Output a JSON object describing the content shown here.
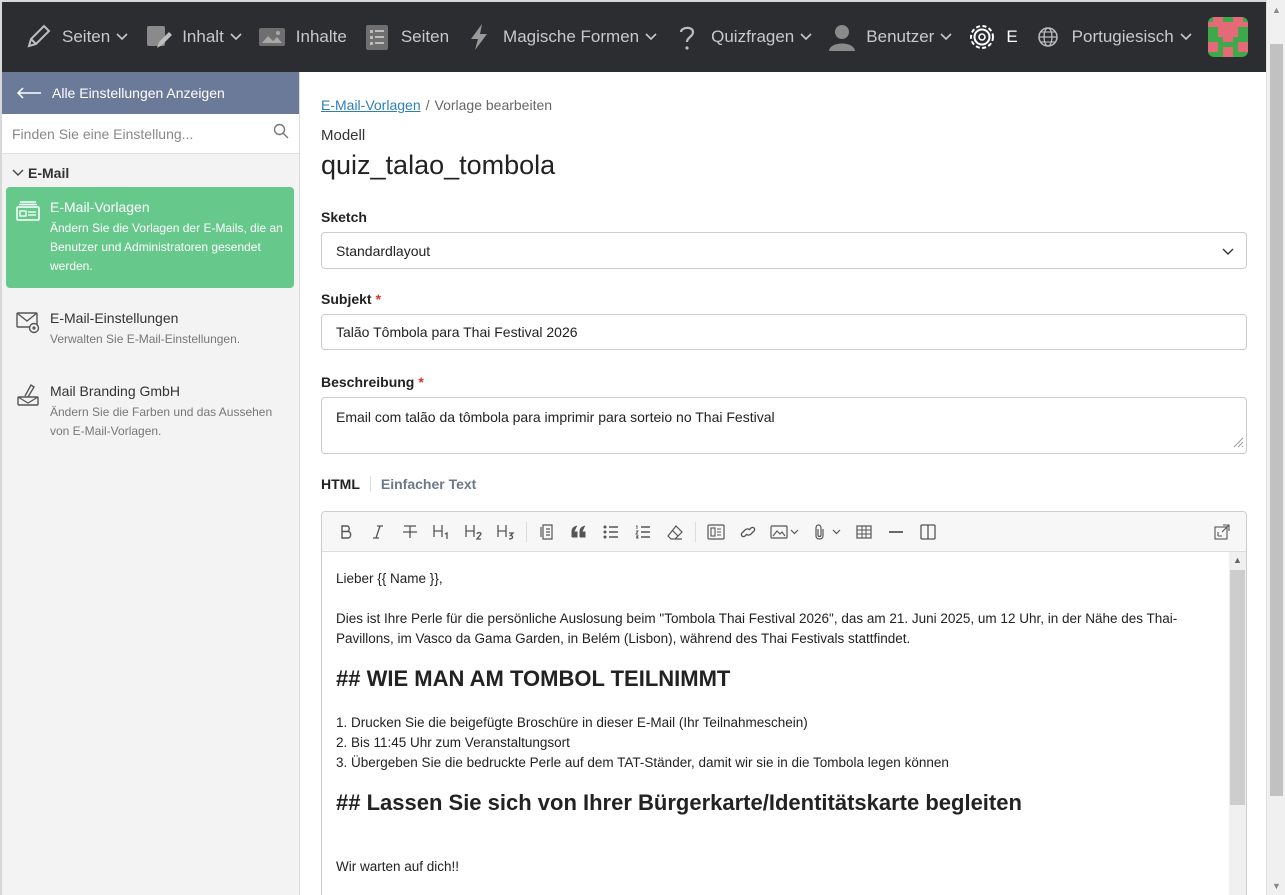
{
  "topnav": {
    "items": [
      {
        "label": "Seiten",
        "icon": "pencil-icon",
        "dropdown": true
      },
      {
        "label": "Inhalt",
        "icon": "content-edit-icon",
        "dropdown": true
      },
      {
        "label": "Inhalte",
        "icon": "image-gallery-icon",
        "dropdown": false
      },
      {
        "label": "Seiten",
        "icon": "checklist-page-icon",
        "dropdown": false
      },
      {
        "label": "Magische Formen",
        "icon": "lightning-icon",
        "dropdown": true
      },
      {
        "label": "Quizfragen",
        "icon": "question-icon",
        "dropdown": true
      },
      {
        "label": "Benutzer",
        "icon": "user-icon",
        "dropdown": true
      },
      {
        "label": "E",
        "icon": "gear-icon",
        "dropdown": false
      },
      {
        "label": "Portugiesisch",
        "icon": "globe-icon",
        "dropdown": true
      }
    ],
    "avatar": "avatar"
  },
  "sidebar": {
    "back_label": "Alle Einstellungen Anzeigen",
    "search_placeholder": "Finden Sie eine Einstellung...",
    "group_title": "E-Mail",
    "items": [
      {
        "title": "E-Mail-Vorlagen",
        "desc": "Ändern Sie die Vorlagen der E-Mails, die an Benutzer und Administratoren gesendet werden.",
        "icon": "email-template-icon"
      },
      {
        "title": "E-Mail-Einstellungen",
        "desc": "Verwalten Sie E-Mail-Einstellungen.",
        "icon": "email-settings-icon"
      },
      {
        "title": "Mail Branding GmbH",
        "desc": "Ändern Sie die Farben und das Aussehen von E-Mail-Vorlagen.",
        "icon": "brush-icon"
      }
    ]
  },
  "main": {
    "breadcrumb_link": "E-Mail-Vorlagen",
    "breadcrumb_sep": "/",
    "breadcrumb_current": "Vorlage bearbeiten",
    "modell_label": "Modell",
    "title": "quiz_talao_tombola",
    "sketch_label": "Sketch",
    "sketch_value": "Standardlayout",
    "subject_label": "Subjekt",
    "subject_value": "Talão Tômbola para Thai Festival 2026",
    "desc_label": "Beschreibung",
    "desc_value": "Email com talão da tômbola para imprimir para sorteio no Thai Festival",
    "required_marker": "*",
    "tab_html": "HTML",
    "tab_text": "Einfacher Text"
  },
  "editor": {
    "greeting": "Lieber {{ Name }},",
    "intro": "Dies ist Ihre Perle für die persönliche Auslosung beim \"Tombola Thai Festival 2026\", das am 21. Juni 2025, um 12 Uhr, in der Nähe des Thai-Pavillons, im Vasco da Gama Garden, in Belém (Lisbon), während des Thai Festivals stattfindet.",
    "heading1": "## WIE MAN AM TOMBOL TEILNIMMT",
    "steps": [
      "1. Drucken Sie die beigefügte Broschüre in dieser E-Mail (Ihr Teilnahmeschein)",
      "2. Bis 11:45 Uhr zum Veranstaltungsort",
      "3. Übergeben Sie die bedruckte Perle auf dem TAT-Ständer, damit wir sie in die Tombola legen können"
    ],
    "heading2": "## Lassen Sie sich von Ihrer Bürgerkarte/Identitätskarte begleiten",
    "closing": "Wir warten auf dich!!"
  }
}
